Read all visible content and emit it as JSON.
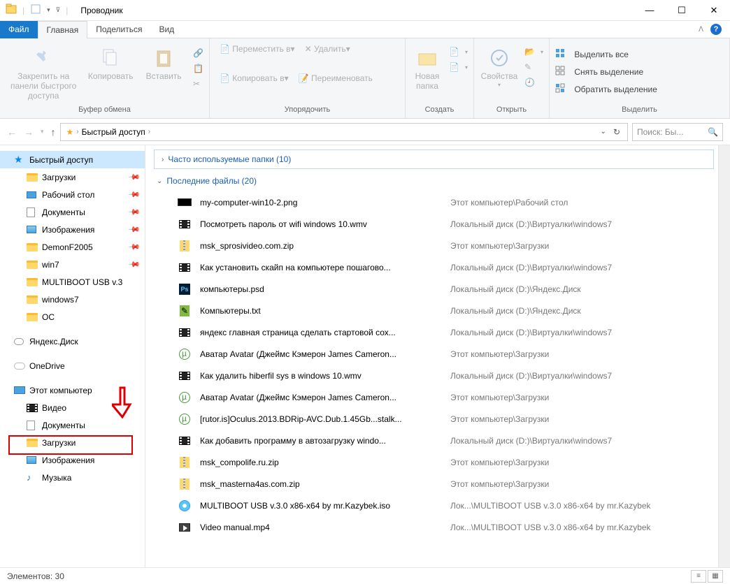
{
  "window": {
    "title": "Проводник"
  },
  "tabs": {
    "file": "Файл",
    "home": "Главная",
    "share": "Поделиться",
    "view": "Вид"
  },
  "ribbon": {
    "clipboard": {
      "pin": "Закрепить на панели быстрого доступа",
      "copy": "Копировать",
      "paste": "Вставить",
      "label": "Буфер обмена"
    },
    "organize": {
      "move_to": "Переместить в",
      "copy_to": "Копировать в",
      "delete": "Удалить",
      "rename": "Переименовать",
      "label": "Упорядочить"
    },
    "new": {
      "new_folder": "Новая папка",
      "label": "Создать"
    },
    "open": {
      "properties": "Свойства",
      "label": "Открыть"
    },
    "select": {
      "select_all": "Выделить все",
      "select_none": "Снять выделение",
      "invert": "Обратить выделение",
      "label": "Выделить"
    }
  },
  "breadcrumb": {
    "root": "Быстрый доступ"
  },
  "search_placeholder": "Поиск: Бы...",
  "sidebar": {
    "quick_access": "Быстрый доступ",
    "items": [
      {
        "label": "Загрузки",
        "pinned": true,
        "icon": "folder"
      },
      {
        "label": "Рабочий стол",
        "pinned": true,
        "icon": "desktop"
      },
      {
        "label": "Документы",
        "pinned": true,
        "icon": "doc"
      },
      {
        "label": "Изображения",
        "pinned": true,
        "icon": "image"
      },
      {
        "label": "DemonF2005",
        "pinned": true,
        "icon": "folder"
      },
      {
        "label": "win7",
        "pinned": true,
        "icon": "folder"
      },
      {
        "label": "MULTIBOOT USB v.3",
        "pinned": false,
        "icon": "folder"
      },
      {
        "label": "windows7",
        "pinned": false,
        "icon": "folder"
      },
      {
        "label": "ОС",
        "pinned": false,
        "icon": "folder"
      }
    ],
    "yandex": "Яндекс.Диск",
    "onedrive": "OneDrive",
    "this_pc": "Этот компьютер",
    "this_pc_children": [
      {
        "label": "Видео",
        "icon": "video"
      },
      {
        "label": "Документы",
        "icon": "doc"
      },
      {
        "label": "Загрузки",
        "icon": "folder"
      },
      {
        "label": "Изображения",
        "icon": "image"
      },
      {
        "label": "Музыка",
        "icon": "music"
      }
    ]
  },
  "groups": {
    "frequent": "Часто используемые папки (10)",
    "recent": "Последние файлы (20)"
  },
  "files": [
    {
      "name": "my-computer-win10-2.png",
      "path": "Этот компьютер\\Рабочий стол",
      "icon": "png"
    },
    {
      "name": "Посмотреть пароль от wifi windows 10.wmv",
      "path": "Локальный диск (D:)\\Виртуалки\\windows7",
      "icon": "video"
    },
    {
      "name": "msk_sprosivideo.com.zip",
      "path": "Этот компьютер\\Загрузки",
      "icon": "zip"
    },
    {
      "name": "Как установить скайп на компьютере пошагово...",
      "path": "Локальный диск (D:)\\Виртуалки\\windows7",
      "icon": "video"
    },
    {
      "name": "компьютеры.psd",
      "path": "Локальный диск (D:)\\Яндекс.Диск",
      "icon": "psd"
    },
    {
      "name": "Компьютеры.txt",
      "path": "Локальный диск (D:)\\Яндекс.Диск",
      "icon": "txt"
    },
    {
      "name": "яндекс главная страница сделать стартовой сох...",
      "path": "Локальный диск (D:)\\Виртуалки\\windows7",
      "icon": "video"
    },
    {
      "name": "Аватар Avatar (Джеймс Кэмерон James Cameron...",
      "path": "Этот компьютер\\Загрузки",
      "icon": "torrent"
    },
    {
      "name": "Как удалить hiberfil sys в windows 10.wmv",
      "path": "Локальный диск (D:)\\Виртуалки\\windows7",
      "icon": "video"
    },
    {
      "name": "Аватар Avatar (Джеймс Кэмерон James Cameron...",
      "path": "Этот компьютер\\Загрузки",
      "icon": "torrent"
    },
    {
      "name": "[rutor.is]Oculus.2013.BDRip-AVC.Dub.1.45Gb...stalk...",
      "path": "Этот компьютер\\Загрузки",
      "icon": "torrent"
    },
    {
      "name": "Как добавить программу в автозагрузку windo...",
      "path": "Локальный диск (D:)\\Виртуалки\\windows7",
      "icon": "video"
    },
    {
      "name": "msk_compolife.ru.zip",
      "path": "Этот компьютер\\Загрузки",
      "icon": "zip"
    },
    {
      "name": "msk_masterna4as.com.zip",
      "path": "Этот компьютер\\Загрузки",
      "icon": "zip"
    },
    {
      "name": "MULTIBOOT USB v.3.0 x86-x64 by mr.Kazybek.iso",
      "path": "Лок...\\MULTIBOOT USB v.3.0 x86-x64 by mr.Kazybek",
      "icon": "iso"
    },
    {
      "name": "Video manual.mp4",
      "path": "Лок...\\MULTIBOOT USB v.3.0 x86-x64 by mr.Kazybek",
      "icon": "mp4"
    }
  ],
  "statusbar": {
    "count_label": "Элементов: 30"
  }
}
